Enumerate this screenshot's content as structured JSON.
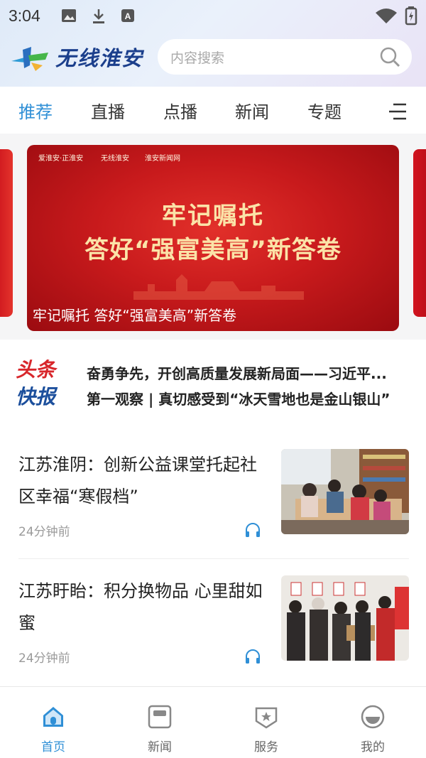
{
  "status_bar": {
    "time": "3:04"
  },
  "header": {
    "logo_text": "无线淮安",
    "search_placeholder": "内容搜索"
  },
  "tabs": [
    {
      "label": "推荐",
      "active": true
    },
    {
      "label": "直播",
      "active": false
    },
    {
      "label": "点播",
      "active": false
    },
    {
      "label": "新闻",
      "active": false
    },
    {
      "label": "专题",
      "active": false
    }
  ],
  "banner": {
    "logos": [
      "爱淮安·正淮安",
      "无线淮安",
      "淮安新闻网"
    ],
    "title_line1": "牢记嘱托",
    "title_line2": "答好“强富美高”新答卷",
    "caption": "牢记嘱托 答好“强富美高”新答卷"
  },
  "headlines": {
    "logo_line1": "头条",
    "logo_line2": "快报",
    "items": [
      "奋勇争先，开创高质量发展新局面——习近平...",
      "第一观察 | 真切感受到“冰天雪地也是金山银山”"
    ]
  },
  "news": [
    {
      "title": "江苏淮阴：创新公益课堂托起社区幸福“寒假档”",
      "time": "24分钟前"
    },
    {
      "title": "江苏盱眙：积分换物品 心里甜如蜜",
      "time": "24分钟前"
    }
  ],
  "bottom_nav": [
    {
      "label": "首页",
      "active": true
    },
    {
      "label": "新闻",
      "active": false
    },
    {
      "label": "服务",
      "active": false
    },
    {
      "label": "我的",
      "active": false
    }
  ],
  "colors": {
    "accent": "#2f8fd6",
    "banner_red": "#c81a1c",
    "headline_blue": "#1c4f9c"
  }
}
